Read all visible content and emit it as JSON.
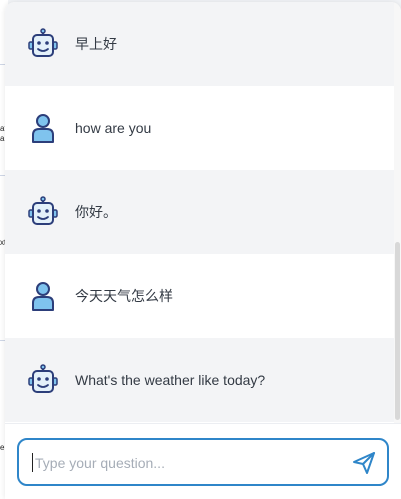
{
  "background_fragments": [
    "at",
    "a",
    "xt",
    "er"
  ],
  "messages": [
    {
      "role": "bot",
      "text": "早上好",
      "avatar_icon": "robot-icon"
    },
    {
      "role": "user",
      "text": "how are you",
      "avatar_icon": "user-icon"
    },
    {
      "role": "bot",
      "text": "你好。",
      "avatar_icon": "robot-icon"
    },
    {
      "role": "user",
      "text": "今天天气怎么样",
      "avatar_icon": "user-icon"
    },
    {
      "role": "bot",
      "text": "What's the weather like today?",
      "avatar_icon": "robot-icon"
    }
  ],
  "input": {
    "placeholder": "Type your question...",
    "value": ""
  },
  "send_icon": "send-icon",
  "colors": {
    "accent": "#2f86c9",
    "bot_row": "#f3f4f6",
    "user_row": "#ffffff",
    "avatar_outline": "#2c3e7a",
    "avatar_fill": "#7fc3ee"
  }
}
